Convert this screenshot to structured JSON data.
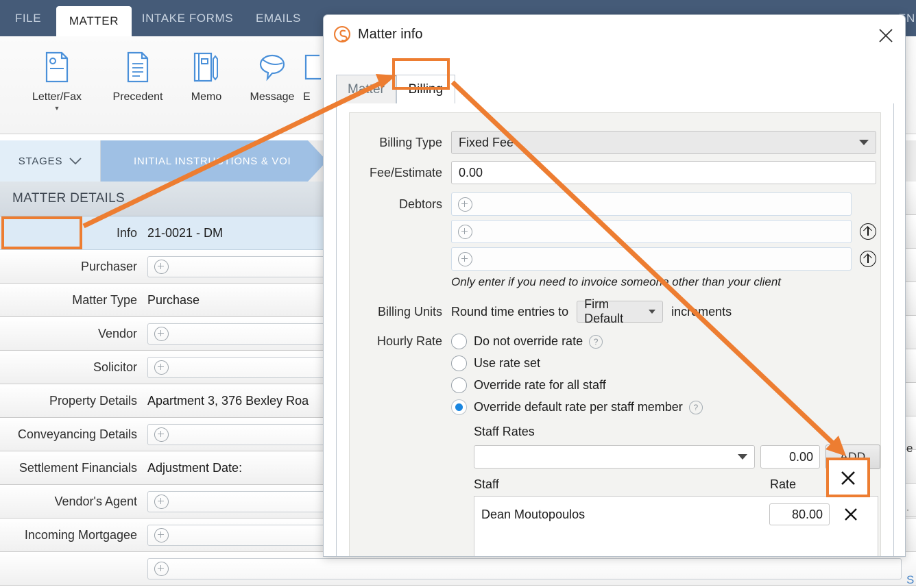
{
  "app": {
    "ribbon_tabs": [
      {
        "label": "FILE",
        "active": false
      },
      {
        "label": "MATTER",
        "active": true
      },
      {
        "label": "INTAKE FORMS",
        "active": false
      },
      {
        "label": "EMAILS",
        "active": false
      },
      {
        "label": "EN",
        "active": false
      }
    ],
    "ribbon_buttons": [
      {
        "label": "Letter/Fax",
        "icon": "letter-fax-icon",
        "has_caret": true
      },
      {
        "label": "Precedent",
        "icon": "document-icon",
        "has_caret": false
      },
      {
        "label": "Memo",
        "icon": "memo-icon",
        "has_caret": false
      },
      {
        "label": "Message",
        "icon": "message-bubble-icon",
        "has_caret": false
      },
      {
        "label": "E",
        "icon": "email-icon",
        "has_caret": false
      }
    ],
    "stages": {
      "button_label": "STAGES",
      "current_stage": "INITIAL INSTRUCTIONS & VOI"
    },
    "matter_details": {
      "header": "MATTER DETAILS",
      "rows": [
        {
          "label": "Info",
          "value": "21-0021 - DM",
          "type": "text",
          "selected": true
        },
        {
          "label": "Purchaser",
          "value": "",
          "type": "add",
          "selected": false
        },
        {
          "label": "Matter Type",
          "value": "Purchase",
          "type": "text",
          "selected": false
        },
        {
          "label": "Vendor",
          "value": "",
          "type": "add",
          "selected": false
        },
        {
          "label": "Solicitor",
          "value": "",
          "type": "add",
          "selected": false
        },
        {
          "label": "Property Details",
          "value": "Apartment 3, 376 Bexley Roa",
          "type": "text",
          "selected": false
        },
        {
          "label": "Conveyancing Details",
          "value": "",
          "type": "add",
          "selected": false
        },
        {
          "label": "Settlement Financials",
          "value": "Adjustment Date:",
          "type": "text",
          "selected": false
        },
        {
          "label": "Vendor's Agent",
          "value": "",
          "type": "add",
          "selected": false
        },
        {
          "label": "Incoming Mortgagee",
          "value": "",
          "type": "add",
          "selected": false
        }
      ]
    }
  },
  "dialog": {
    "title": "Matter info",
    "logo_icon": "smokeball-s-logo-icon",
    "close_icon": "close-icon",
    "tabs": [
      {
        "label": "Matter",
        "active": false
      },
      {
        "label": "Billing",
        "active": true
      }
    ],
    "billing": {
      "billing_type": {
        "label": "Billing Type",
        "value": "Fixed Fee",
        "caret_icon": "chevron-down-icon"
      },
      "fee_estimate": {
        "label": "Fee/Estimate",
        "value": "0.00"
      },
      "debtors": {
        "label": "Debtors",
        "rows": [
          {
            "placeholder": "",
            "has_move_up": false
          },
          {
            "placeholder": "",
            "has_move_up": true
          },
          {
            "placeholder": "",
            "has_move_up": true
          }
        ],
        "add_icon": "plus-circle-icon",
        "move_up_icon": "arrow-up-circle-icon",
        "hint": "Only enter if you need to invoice someone other than your client"
      },
      "billing_units": {
        "label": "Billing Units",
        "prefix_text": "Round time entries to",
        "value": "Firm Default",
        "suffix_text": "increments",
        "caret_icon": "chevron-down-icon"
      },
      "hourly_rate": {
        "label": "Hourly Rate",
        "options": [
          {
            "label": "Do not override rate",
            "selected": false,
            "has_help": true
          },
          {
            "label": "Use rate set",
            "selected": false,
            "has_help": false
          },
          {
            "label": "Override rate for all staff",
            "selected": false,
            "has_help": false
          },
          {
            "label": "Override default rate per staff member",
            "selected": true,
            "has_help": true
          }
        ],
        "help_icon": "question-mark-icon"
      },
      "staff_rates": {
        "section_label": "Staff Rates",
        "staff_select_value": "",
        "staff_select_caret_icon": "chevron-down-icon",
        "new_rate_value": "0.00",
        "add_button_label": "ADD",
        "columns": [
          "Staff",
          "Rate"
        ],
        "rows": [
          {
            "staff": "Dean Moutopoulos",
            "rate": "80.00",
            "remove_icon": "close-x-icon"
          }
        ]
      }
    }
  },
  "annotations": {
    "accent_color": "#ED7D31",
    "highlights": [
      {
        "name": "info-row-highlight",
        "target": "Info"
      },
      {
        "name": "billing-tab-highlight",
        "target": "Billing"
      },
      {
        "name": "remove-staff-rate-highlight",
        "target": "X"
      }
    ],
    "arrows": [
      {
        "name": "info-to-billing-tab-arrow",
        "from": "Info",
        "to": "Billing"
      },
      {
        "name": "billing-tab-to-remove-button-arrow",
        "from": "Billing",
        "to": "X"
      }
    ]
  },
  "colors": {
    "ribbon_header": "#455B78",
    "stage_chevron": "#9FC0E4",
    "selected_row": "#DCEAF6",
    "accent_orange": "#ED7D31",
    "radio_blue": "#1A86E0"
  }
}
